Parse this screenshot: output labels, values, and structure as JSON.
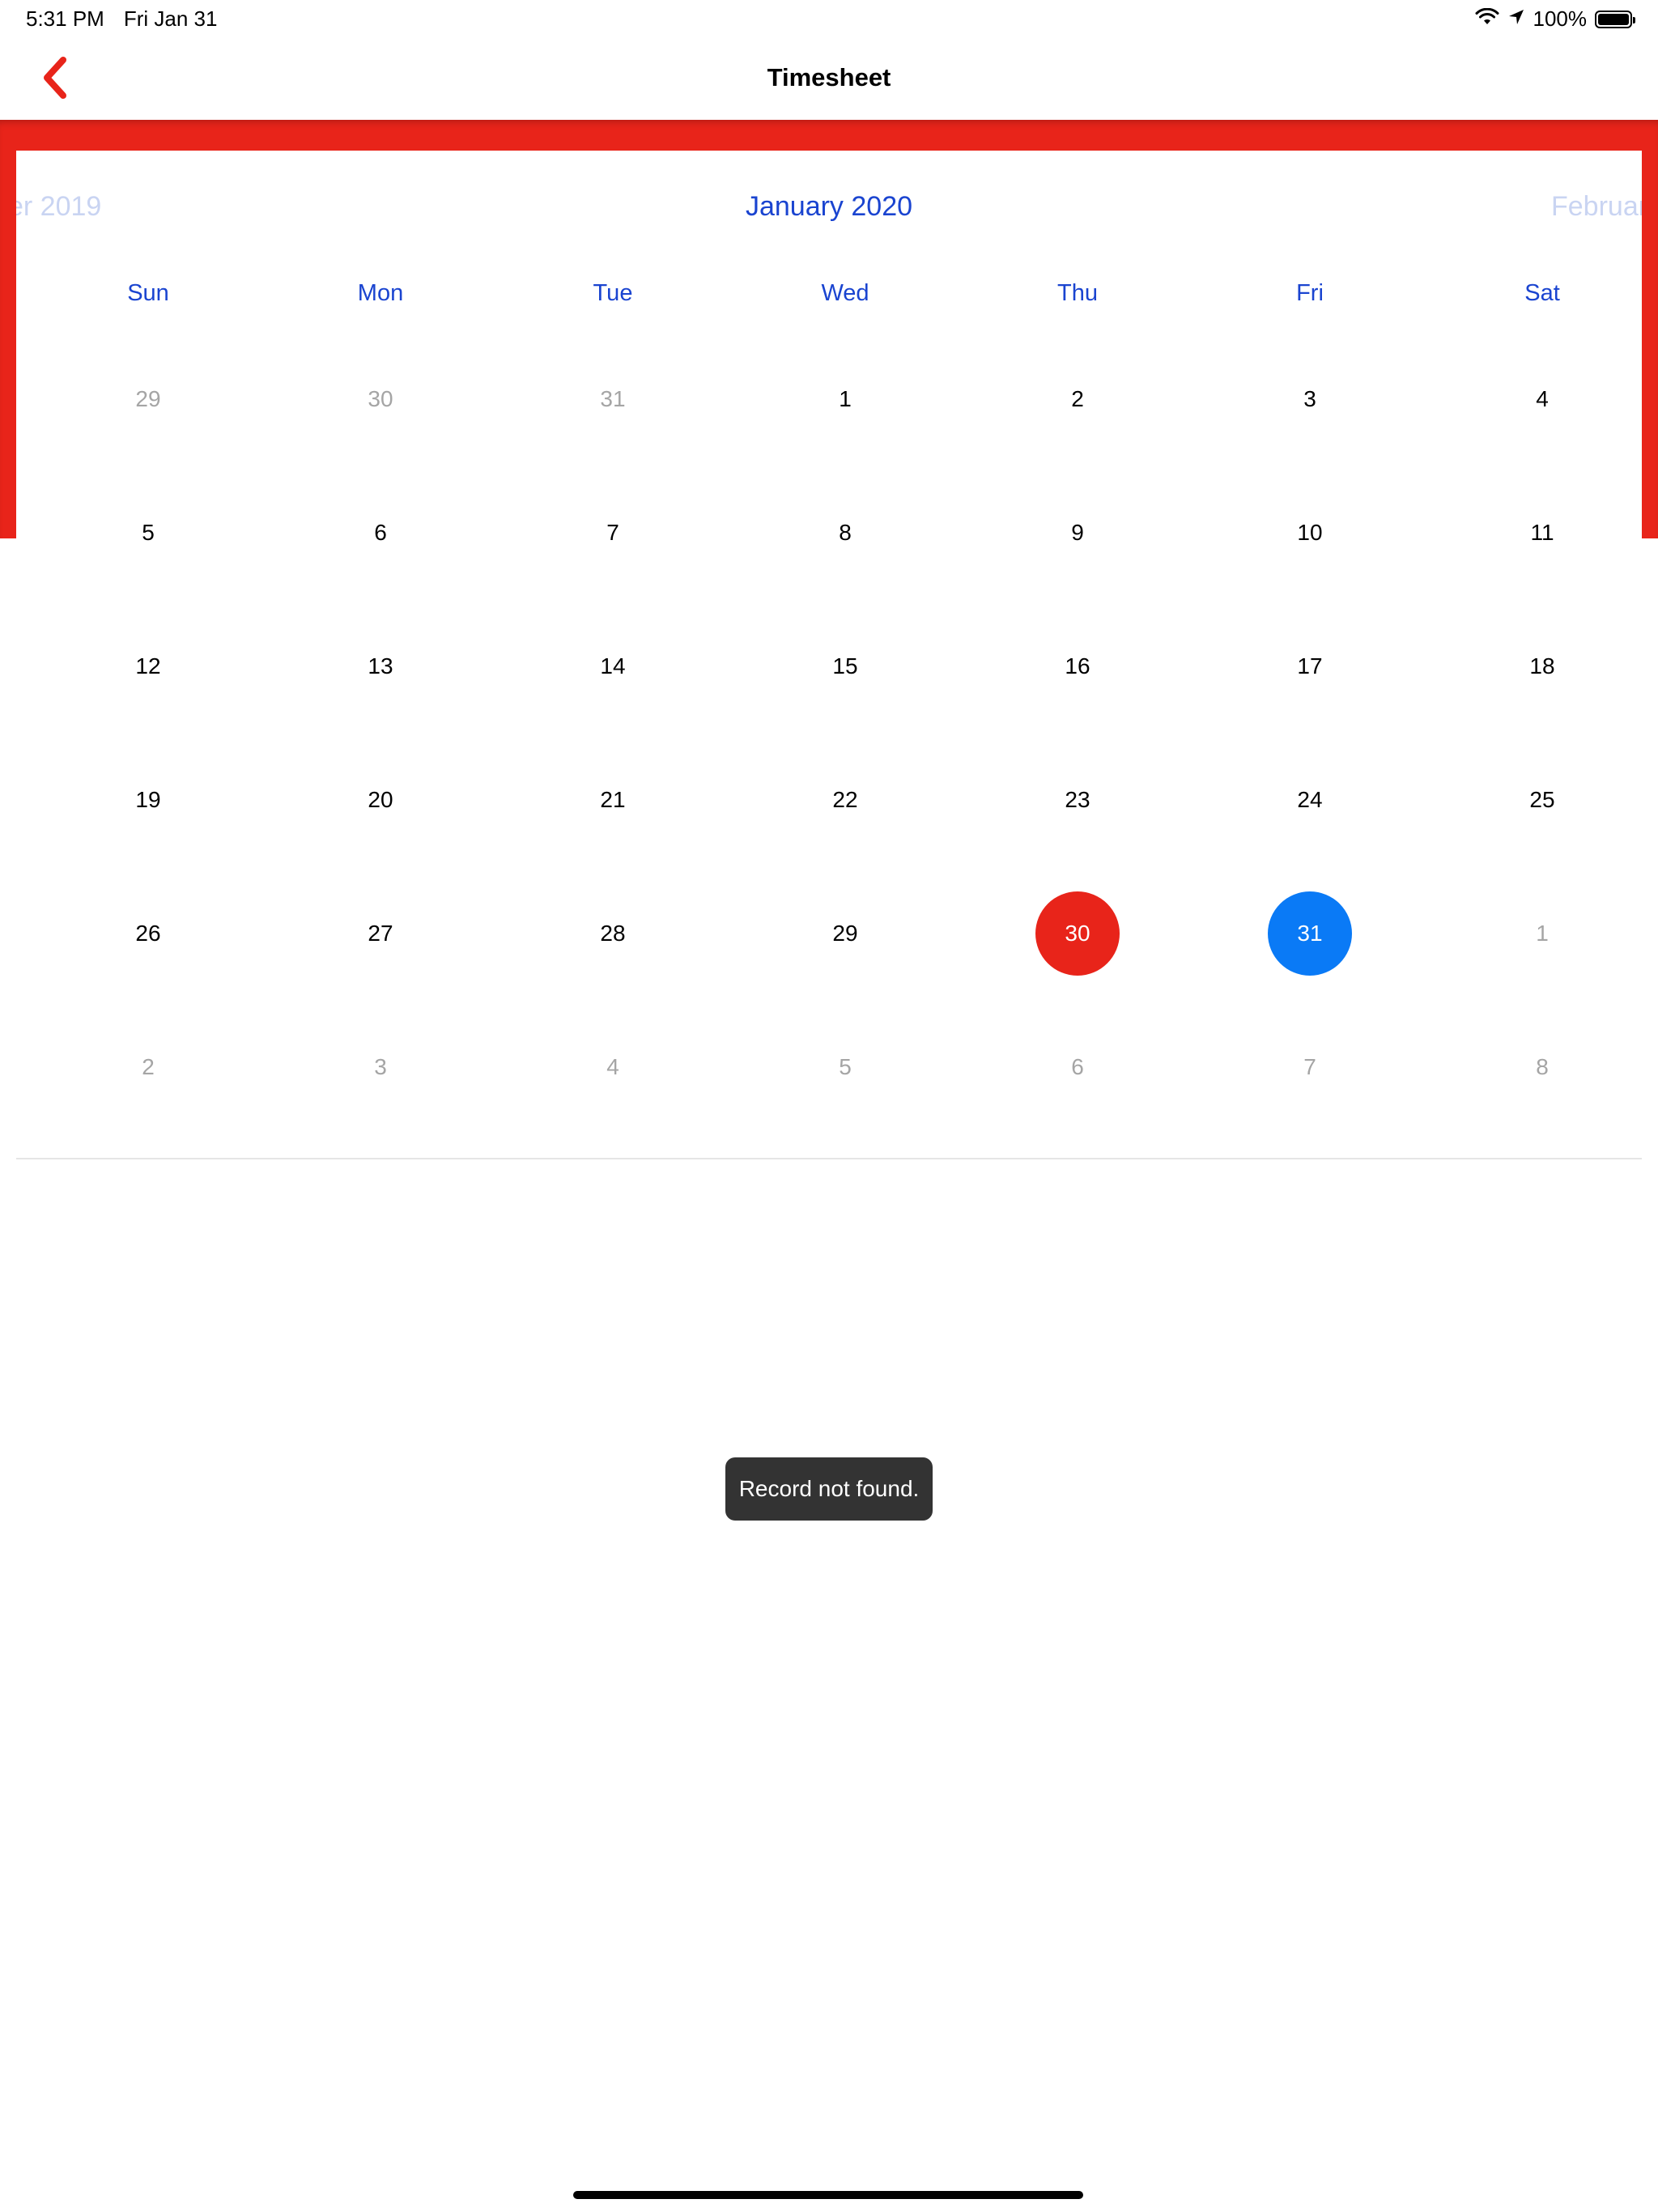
{
  "status_bar": {
    "time": "5:31 PM",
    "date": "Fri Jan 31",
    "battery_percent": "100%",
    "icons": [
      "wifi-icon",
      "location-arrow-icon",
      "battery-icon"
    ]
  },
  "nav": {
    "title": "Timesheet",
    "back_icon": "chevron-left-icon",
    "accent_color": "#e8241a"
  },
  "calendar": {
    "prev_month": "er 2019",
    "current_month": "January 2020",
    "next_month": "Februar",
    "weekdays": [
      "Sun",
      "Mon",
      "Tue",
      "Wed",
      "Thu",
      "Fri",
      "Sat"
    ],
    "weeks": [
      [
        {
          "d": "29",
          "muted": true
        },
        {
          "d": "30",
          "muted": true
        },
        {
          "d": "31",
          "muted": true
        },
        {
          "d": "1"
        },
        {
          "d": "2"
        },
        {
          "d": "3"
        },
        {
          "d": "4"
        }
      ],
      [
        {
          "d": "5"
        },
        {
          "d": "6"
        },
        {
          "d": "7"
        },
        {
          "d": "8"
        },
        {
          "d": "9"
        },
        {
          "d": "10"
        },
        {
          "d": "11"
        }
      ],
      [
        {
          "d": "12"
        },
        {
          "d": "13"
        },
        {
          "d": "14"
        },
        {
          "d": "15"
        },
        {
          "d": "16"
        },
        {
          "d": "17"
        },
        {
          "d": "18"
        }
      ],
      [
        {
          "d": "19"
        },
        {
          "d": "20"
        },
        {
          "d": "21"
        },
        {
          "d": "22"
        },
        {
          "d": "23"
        },
        {
          "d": "24"
        },
        {
          "d": "25"
        }
      ],
      [
        {
          "d": "26"
        },
        {
          "d": "27"
        },
        {
          "d": "28"
        },
        {
          "d": "29"
        },
        {
          "d": "30",
          "state": "today"
        },
        {
          "d": "31",
          "state": "selected"
        },
        {
          "d": "1",
          "muted": true
        }
      ],
      [
        {
          "d": "2",
          "muted": true
        },
        {
          "d": "3",
          "muted": true
        },
        {
          "d": "4",
          "muted": true
        },
        {
          "d": "5",
          "muted": true
        },
        {
          "d": "6",
          "muted": true
        },
        {
          "d": "7",
          "muted": true
        },
        {
          "d": "8",
          "muted": true
        }
      ]
    ],
    "today_color": "#e8241a",
    "selected_color": "#0a7af6"
  },
  "toast": {
    "message": "Record not found."
  }
}
